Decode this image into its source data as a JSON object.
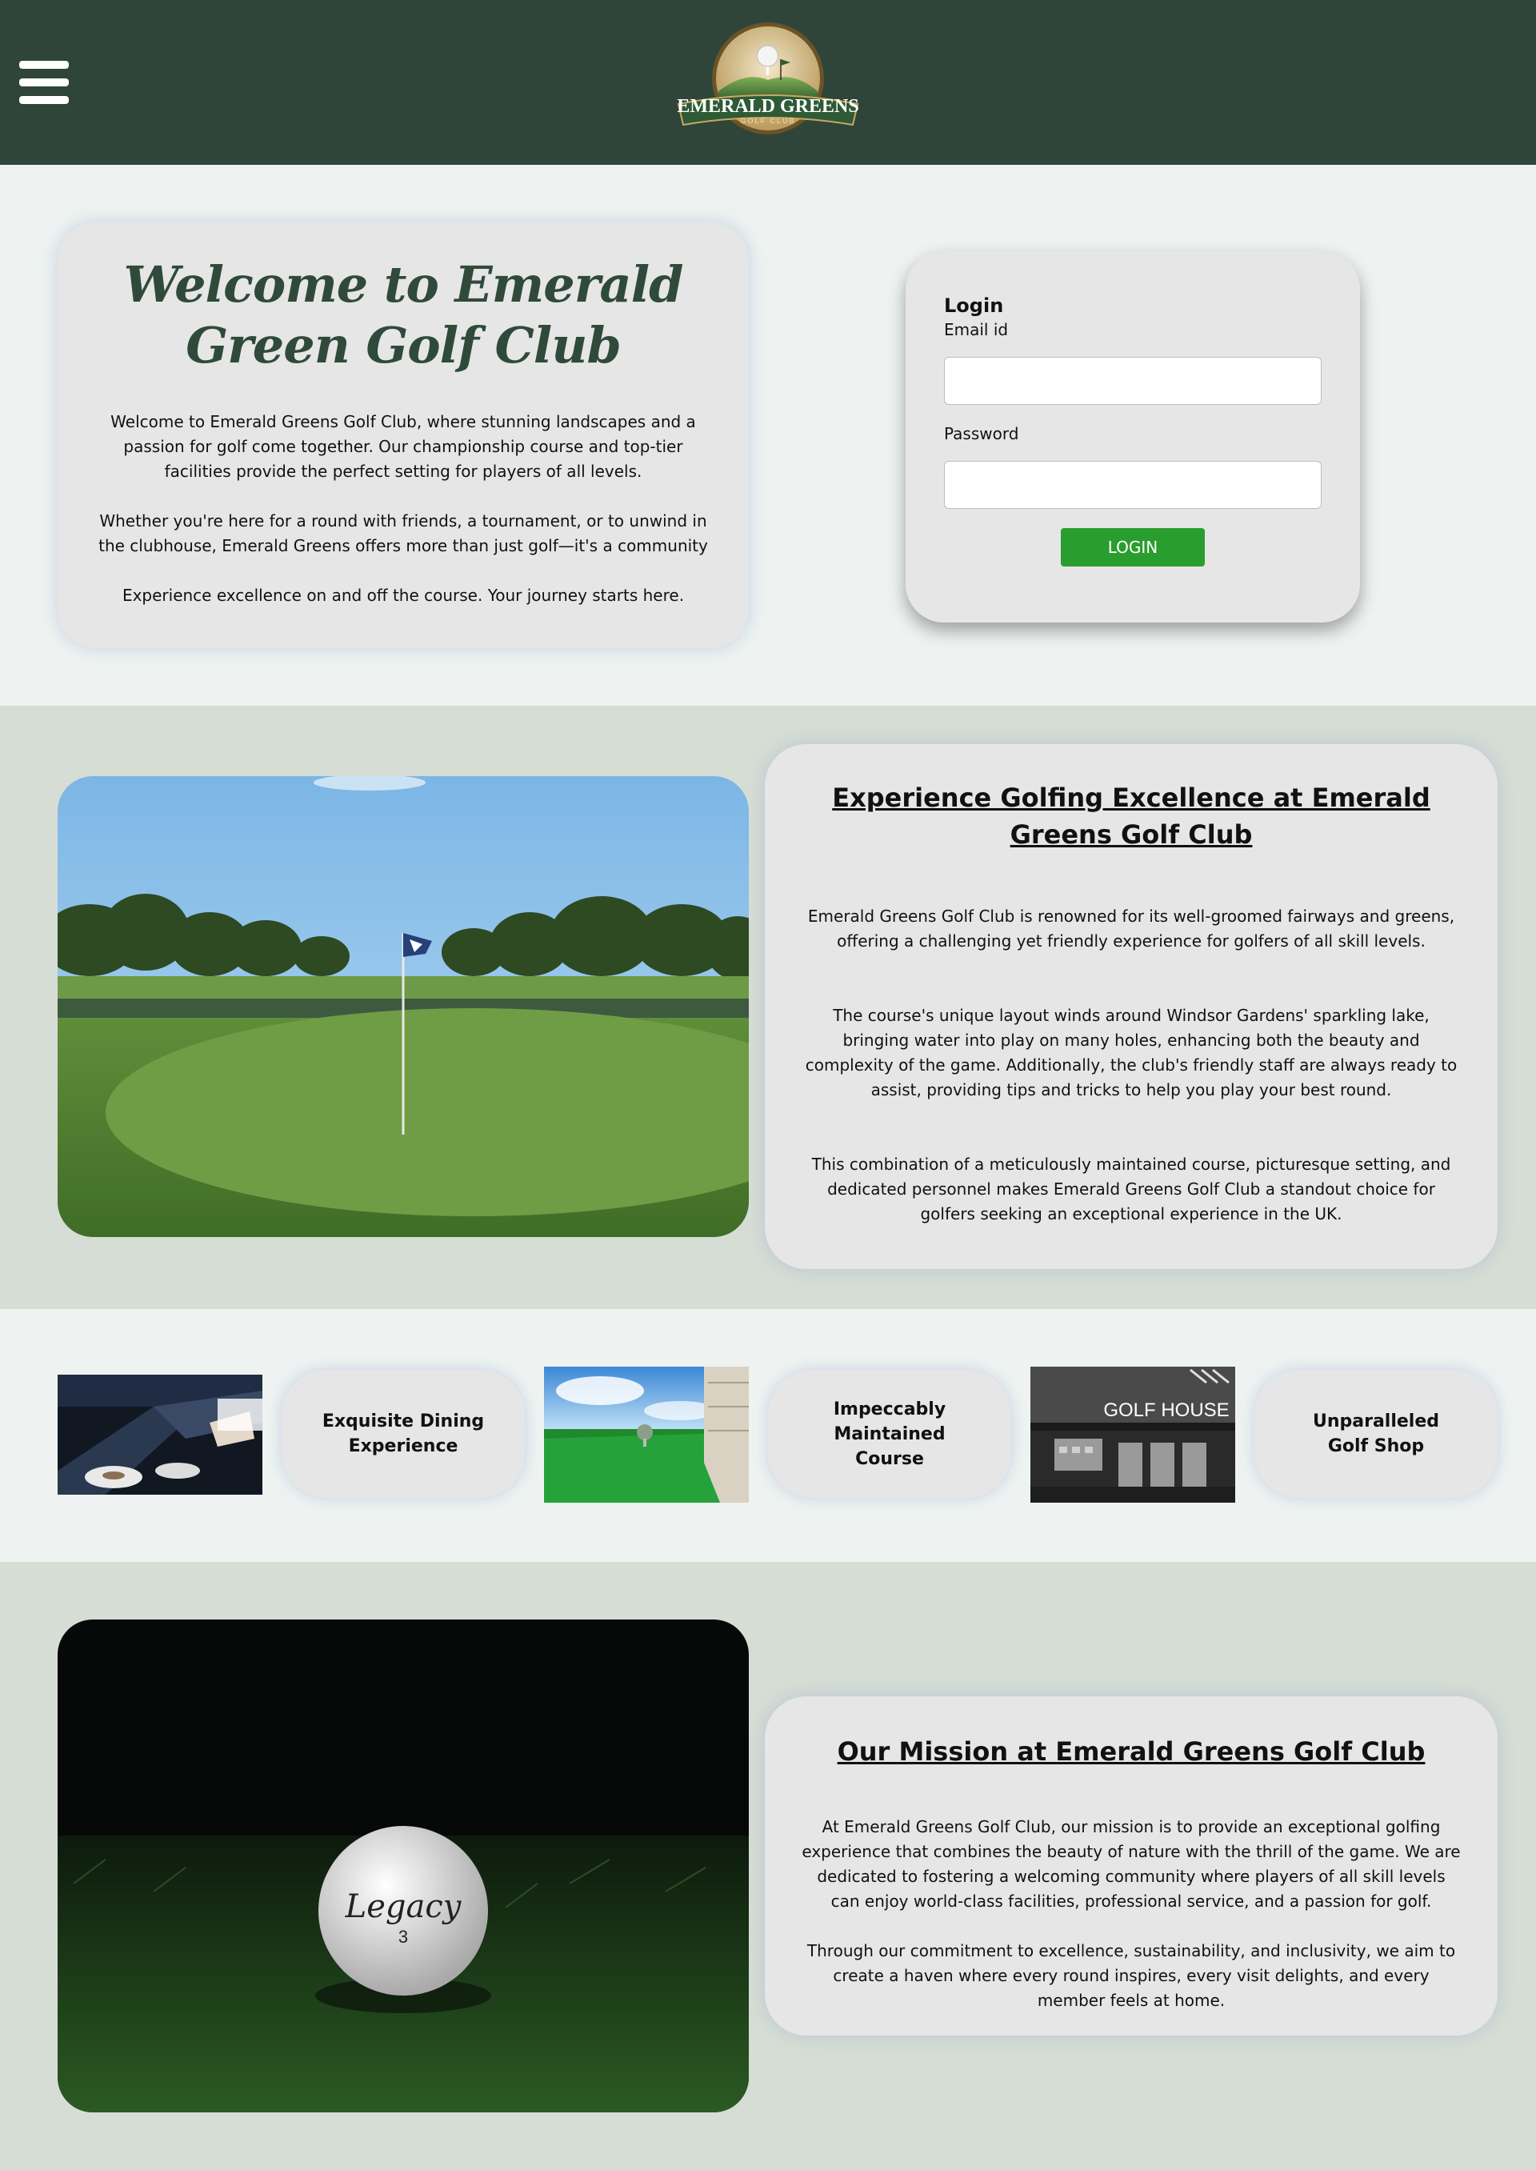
{
  "header": {
    "menu_icon": "hamburger-menu-icon",
    "logo": {
      "name": "EMERALD GREENS",
      "subtitle": "GOLF CLUB"
    },
    "colors": {
      "background": "#2f453a"
    }
  },
  "welcome": {
    "title": "Welcome to Emerald Green Golf Club",
    "paragraphs": [
      "Welcome to Emerald Greens Golf Club, where stunning landscapes and a passion for golf come together. Our championship course and top-tier facilities provide the perfect setting for players of all levels.",
      "Whether you're here for a round with friends, a tournament, or to unwind in the clubhouse, Emerald Greens offers more than just golf—it's a community",
      "Experience excellence on and off the course. Your journey starts here."
    ]
  },
  "login": {
    "title": "Login",
    "email_label": "Email id",
    "email_value": "",
    "password_label": "Password",
    "password_value": "",
    "button_label": "LOGIN",
    "colors": {
      "button": "#2a9d2f"
    }
  },
  "experience": {
    "title": "Experience Golfing Excellence at Emerald Greens Golf Club",
    "paragraphs": [
      "Emerald Greens Golf Club is renowned for its well-groomed fairways and greens, offering a challenging yet friendly experience for golfers of all skill levels.",
      "The course's unique layout winds around Windsor Gardens' sparkling lake, bringing water into play on many holes, enhancing both the beauty and complexity of the game. Additionally, the club's friendly staff are always ready to assist, providing tips and tricks to help you play your best round.",
      "This combination of a meticulously maintained course, picturesque setting, and dedicated personnel makes Emerald Greens Golf Club a standout choice for golfers seeking an exceptional experience in the UK."
    ]
  },
  "features": [
    {
      "label": "Exquisite Dining Experience",
      "image": "chef-plating-image"
    },
    {
      "label": "Impeccably Maintained Course",
      "image": "golf-ball-on-tee-image"
    },
    {
      "label": "Unparalleled Golf Shop",
      "image": "golf-house-shop-image",
      "image_text": "GOLF HOUSE"
    }
  ],
  "mission": {
    "title": "Our Mission at Emerald Greens Golf Club",
    "paragraphs": [
      "At Emerald Greens Golf Club, our mission is to provide an exceptional golfing experience that combines the beauty of nature with the thrill of the game. We are dedicated to fostering a welcoming community where players of all skill levels can enjoy world-class facilities, professional service, and a passion for golf.",
      "Through our commitment to excellence, sustainability, and inclusivity, we aim to create a haven where every round inspires, every visit delights, and every member feels at home."
    ],
    "image_text": {
      "brand": "Legacy",
      "number": "3"
    }
  }
}
